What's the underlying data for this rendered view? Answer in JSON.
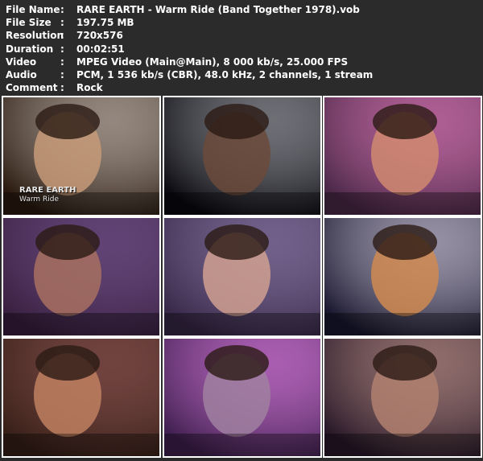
{
  "info": [
    {
      "key": "File Name",
      "sep": ":",
      "value": "RARE EARTH - Warm Ride (Band Together 1978).vob"
    },
    {
      "key": "File Size",
      "sep": ":",
      "value": "197.75 MB"
    },
    {
      "key": "Resolution",
      "sep": ":",
      "value": "720x576"
    },
    {
      "key": "Duration",
      "sep": ":",
      "value": "00:02:51"
    },
    {
      "key": "Video",
      "sep": ":",
      "value": "MPEG Video (Main@Main), 8 000 kb/s, 25.000 FPS"
    },
    {
      "key": "Audio",
      "sep": ":",
      "value": "PCM, 1 536 kb/s (CBR), 48.0 kHz, 2 channels, 1 stream"
    },
    {
      "key": "Comment",
      "sep": ":",
      "value": "Rock"
    }
  ],
  "overlay": {
    "band": "RARE EARTH",
    "song": "Warm Ride"
  },
  "thumbs": [
    {
      "name": "frame-1-singer-closeup",
      "bg": "#2a1a10",
      "fg": "#c79a78",
      "accent": "#e8e0d8"
    },
    {
      "name": "frame-2-keyboards-dark",
      "bg": "#0a0a10",
      "fg": "#6a4a3a",
      "accent": "#c0c0c8"
    },
    {
      "name": "frame-3-singer-mic-purple",
      "bg": "#4a2848",
      "fg": "#d08a70",
      "accent": "#ff8ad0"
    },
    {
      "name": "frame-4-musician-portrait",
      "bg": "#3a2040",
      "fg": "#a87060",
      "accent": "#8060a0"
    },
    {
      "name": "frame-5-singer-profile",
      "bg": "#382848",
      "fg": "#d0a090",
      "accent": "#a090c0"
    },
    {
      "name": "frame-6-trumpet-lights",
      "bg": "#1a1830",
      "fg": "#d08a50",
      "accent": "#f8f0ff"
    },
    {
      "name": "frame-7-singer-eyes-closed",
      "bg": "#382018",
      "fg": "#c08060",
      "accent": "#a06060"
    },
    {
      "name": "frame-8-stage-pink-lights",
      "bg": "#402050",
      "fg": "#a080a0",
      "accent": "#ff90ff"
    },
    {
      "name": "frame-9-two-singers",
      "bg": "#281828",
      "fg": "#b08070",
      "accent": "#e0b0a0"
    }
  ]
}
